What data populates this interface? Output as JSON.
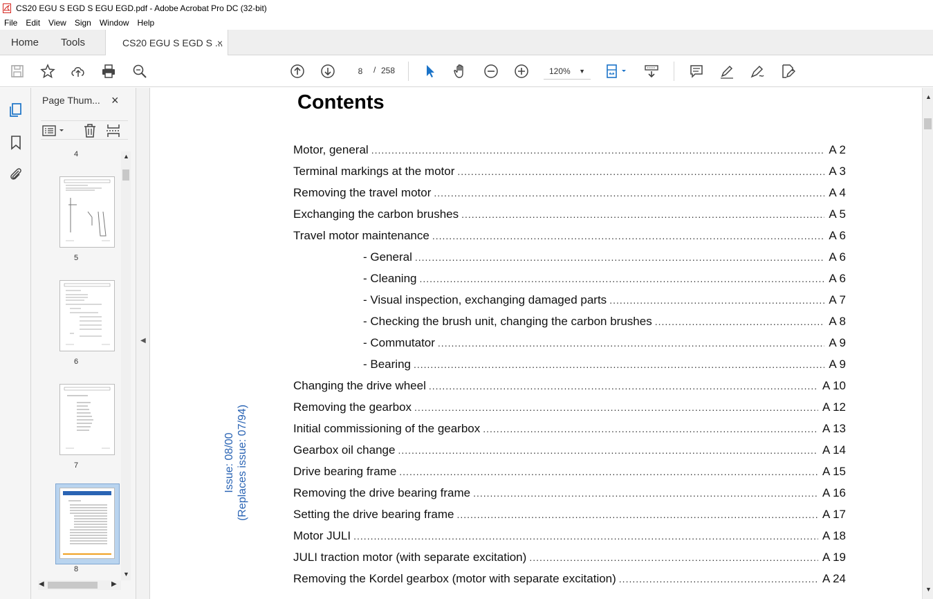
{
  "window": {
    "title": "CS20 EGU S EGD S EGU EGD.pdf - Adobe Acrobat Pro DC (32-bit)"
  },
  "menu": [
    "File",
    "Edit",
    "View",
    "Sign",
    "Window",
    "Help"
  ],
  "tabs": {
    "home": "Home",
    "tools": "Tools",
    "document": "CS20 EGU S EGD S ...",
    "close": "×"
  },
  "toolbar": {
    "current_page": "8",
    "separator": "/",
    "total_pages": "258",
    "zoom": "120%"
  },
  "thumbnails": {
    "header": "Page Thum...",
    "close": "×",
    "pages": [
      {
        "number": "4"
      },
      {
        "number": "5"
      },
      {
        "number": "6"
      },
      {
        "number": "7"
      },
      {
        "number": "8",
        "selected": true
      }
    ]
  },
  "document": {
    "title": "Contents",
    "issue_line1": "Issue:  08/00",
    "issue_line2": "(Replaces issue:  07/94)",
    "toc": [
      {
        "label": "Motor, general",
        "page": "A 2",
        "indent": false
      },
      {
        "label": "Terminal markings at the motor",
        "page": "A 3",
        "indent": false
      },
      {
        "label": "Removing the travel motor",
        "page": "A 4",
        "indent": false
      },
      {
        "label": "Exchanging the carbon brushes ",
        "page": "A 5",
        "indent": false
      },
      {
        "label": "Travel motor maintenance",
        "page": "A 6",
        "indent": false
      },
      {
        "label": "- General",
        "page": "A 6",
        "indent": true
      },
      {
        "label": "- Cleaning ",
        "page": "A 6",
        "indent": true
      },
      {
        "label": "- Visual inspection, exchanging damaged parts ",
        "page": "A 7",
        "indent": true
      },
      {
        "label": "- Checking the brush unit, changing the carbon brushes ",
        "page": "A 8",
        "indent": true
      },
      {
        "label": "- Commutator ",
        "page": "A 9",
        "indent": true
      },
      {
        "label": "- Bearing",
        "page": "A 9",
        "indent": true
      },
      {
        "label": "Changing the drive wheel",
        "page": "A 10",
        "indent": false
      },
      {
        "label": "Removing the gearbox",
        "page": "A 12",
        "indent": false
      },
      {
        "label": "Initial commissioning of the gearbox ",
        "page": "A 13",
        "indent": false
      },
      {
        "label": "Gearbox oil change ",
        "page": "A 14",
        "indent": false
      },
      {
        "label": "Drive bearing frame",
        "page": "A 15",
        "indent": false
      },
      {
        "label": "Removing the drive bearing frame ",
        "page": "A 16",
        "indent": false
      },
      {
        "label": "Setting the drive bearing frame ",
        "page": "A 17",
        "indent": false
      },
      {
        "label": "Motor JULI  ",
        "page": "A 18",
        "indent": false
      },
      {
        "label": "JULI traction motor (with separate excitation) ",
        "page": "A 19",
        "indent": false
      },
      {
        "label": "Removing the Kordel gearbox (motor with separate excitation)",
        "page": "A 24",
        "indent": false
      }
    ]
  },
  "colors": {
    "accent_blue": "#2a64b4",
    "selected_thumb": "#b9d4ef",
    "pdf_red": "#d4261f"
  }
}
